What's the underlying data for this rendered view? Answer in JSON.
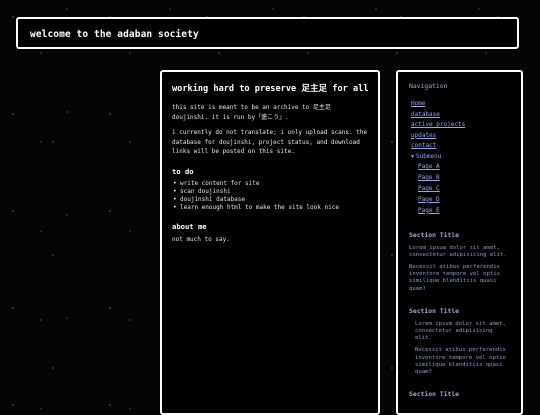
{
  "header": {
    "title": "welcome to the adaban society"
  },
  "main": {
    "heading": "working hard to preserve 足主足 for all",
    "intro": "this site is meant to be an archive to 足主足 doujinshi. it is run by「盛こう」.",
    "note": "i currently do not translate; i only upload scans. the database for doujinshi, project status, and download links will be posted on this site.",
    "todo_heading": "to do",
    "todo_items": [
      "write content for site",
      "scan doujinshi",
      "doujinshi database",
      "learn enough html to make the site look nice"
    ],
    "about_heading": "about me",
    "about_text": "not much to say."
  },
  "sidebar": {
    "nav_title": "Navigation",
    "nav_items": [
      "Home",
      "database",
      "active projects",
      "updates",
      "contact"
    ],
    "submenu_label": "Submenu",
    "submenu_items": [
      "Page A",
      "Page B",
      "Page C",
      "Page D",
      "Page E"
    ],
    "sections": [
      {
        "title": "Section Title",
        "p1": "Lorem ipsum dolor sit amet, consectetur adipisicing elit.",
        "p2": "Necessit atibus perferendis inventore tempore vel optio similique blanditiis quasi quam?"
      },
      {
        "title": "Section Title",
        "p1": "Lorem ipsum dolor sit amet, consectetur adipisicing elit.",
        "p2": "Necessit atibus perferendis inventore tempore vel optio similique blanditiis quasi quam?"
      },
      {
        "title": "Section Title"
      }
    ]
  }
}
